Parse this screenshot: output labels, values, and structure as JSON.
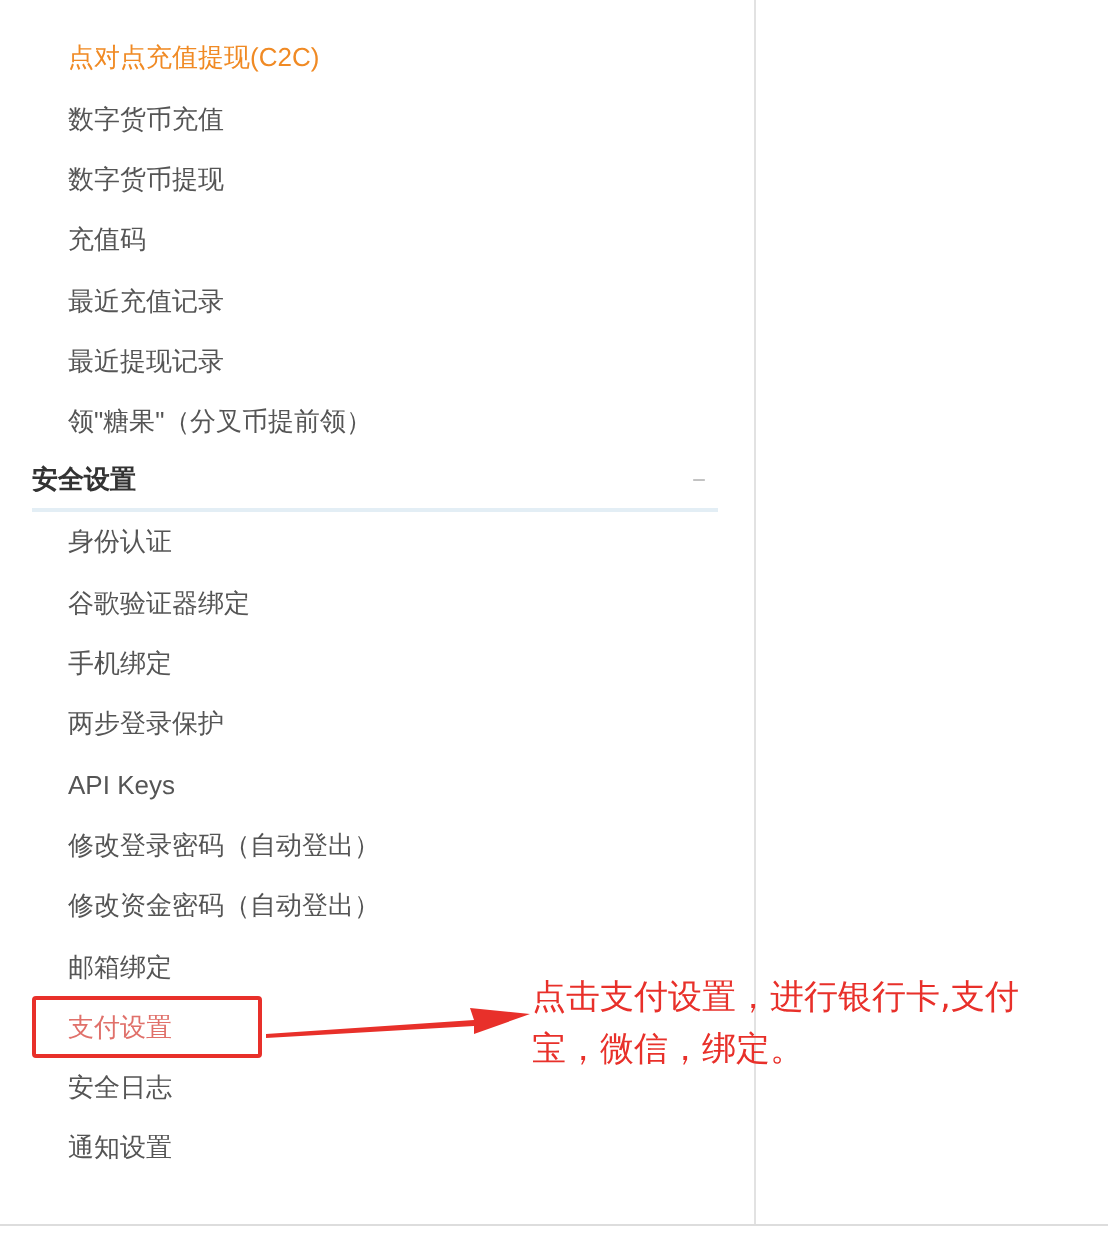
{
  "sidebar": {
    "groups": [
      {
        "items": [
          {
            "label": "点对点充值提现(C2C)",
            "selected": true,
            "highlighted": false
          },
          {
            "label": "数字货币充值",
            "selected": false,
            "highlighted": false
          },
          {
            "label": "数字货币提现",
            "selected": false,
            "highlighted": false
          },
          {
            "label": "充值码",
            "selected": false,
            "highlighted": false
          },
          {
            "label": "最近充值记录",
            "selected": false,
            "highlighted": false
          },
          {
            "label": "最近提现记录",
            "selected": false,
            "highlighted": false
          },
          {
            "label": "领\"糖果\"（分叉币提前领）",
            "selected": false,
            "highlighted": false
          }
        ]
      },
      {
        "title": "安全设置",
        "toggle": "−",
        "items": [
          {
            "label": "身份认证",
            "selected": false,
            "highlighted": false
          },
          {
            "label": "谷歌验证器绑定",
            "selected": false,
            "highlighted": false
          },
          {
            "label": "手机绑定",
            "selected": false,
            "highlighted": false
          },
          {
            "label": "两步登录保护",
            "selected": false,
            "highlighted": false
          },
          {
            "label": "API Keys",
            "selected": false,
            "highlighted": false
          },
          {
            "label": "修改登录密码（自动登出）",
            "selected": false,
            "highlighted": false
          },
          {
            "label": "修改资金密码（自动登出）",
            "selected": false,
            "highlighted": false
          },
          {
            "label": "邮箱绑定",
            "selected": false,
            "highlighted": false
          },
          {
            "label": "支付设置",
            "selected": true,
            "highlighted": true
          },
          {
            "label": "安全日志",
            "selected": false,
            "highlighted": false
          },
          {
            "label": "通知设置",
            "selected": false,
            "highlighted": false
          }
        ]
      }
    ]
  },
  "annotation": {
    "text": "点击支付设置，进行银行卡,支付宝，微信，绑定。"
  }
}
